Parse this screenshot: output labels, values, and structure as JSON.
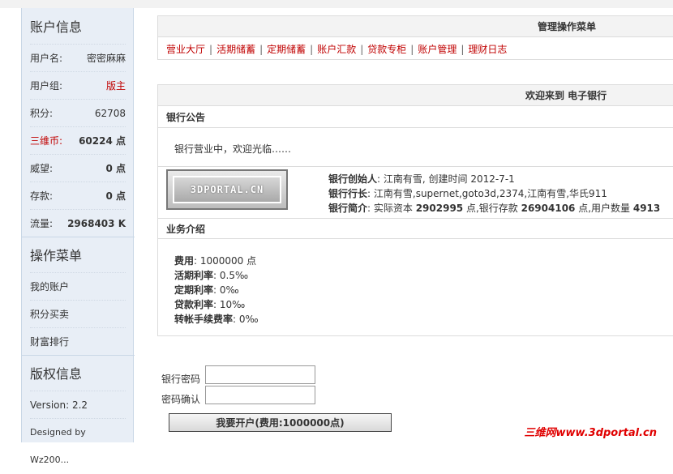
{
  "sidebar": {
    "account_title": "账户信息",
    "rows": [
      {
        "label": "用户名:",
        "value": "密密麻麻"
      },
      {
        "label": "用户组:",
        "value": "版主"
      },
      {
        "label": "积分:",
        "value": "62708"
      },
      {
        "label": "三维币:",
        "value": "60224 点"
      },
      {
        "label": "威望:",
        "value": "0 点"
      },
      {
        "label": "存款:",
        "value": "0 点"
      },
      {
        "label": "流量:",
        "value": "2968403 K"
      }
    ],
    "menu_title": "操作菜单",
    "menu_items": [
      "我的账户",
      "积分买卖",
      "财富排行"
    ],
    "copyright_title": "版权信息",
    "version": "Version: 2.2",
    "designed_by": "Designed by Wz200..."
  },
  "admin_menu": {
    "title": "管理操作菜单",
    "links": [
      "营业大厅",
      "活期储蓄",
      "定期储蓄",
      "账户汇款",
      "贷款专柜",
      "账户管理",
      "理财日志"
    ]
  },
  "welcome": {
    "title": "欢迎来到 电子银行",
    "notice_heading": "银行公告",
    "notice_text": "银行营业中，欢迎光临……",
    "logo_text": "3DPORTAL.CN",
    "founder_label": "银行创始人",
    "founder_value": ": 江南有雪, 创建时间  2012-7-1",
    "president_label": "银行行长",
    "president_value": ": 江南有雪,supernet,goto3d,2374,江南有雪,华氏911",
    "intro_label": "银行简介",
    "intro_prefix": ": 实际资本 ",
    "capital": "2902995",
    "intro_mid": " 点,银行存款 ",
    "deposits": "26904106",
    "intro_mid2": " 点,用户数量 ",
    "users": "4913",
    "business_heading": "业务介绍",
    "business": [
      {
        "label": "费用",
        "value": ": 1000000 点"
      },
      {
        "label": "活期利率",
        "value": ": 0.5‰"
      },
      {
        "label": "定期利率",
        "value": ": 0‰"
      },
      {
        "label": "贷款利率",
        "value": ": 10‰"
      },
      {
        "label": "转帐手续费率",
        "value": ": 0‰"
      }
    ]
  },
  "form": {
    "password_label": "银行密码",
    "confirm_label": "密码确认",
    "password_value": "",
    "confirm_value": "",
    "submit_label": "我要开户(费用:1000000点)"
  },
  "watermark": "三维网www.3dportal.cn"
}
